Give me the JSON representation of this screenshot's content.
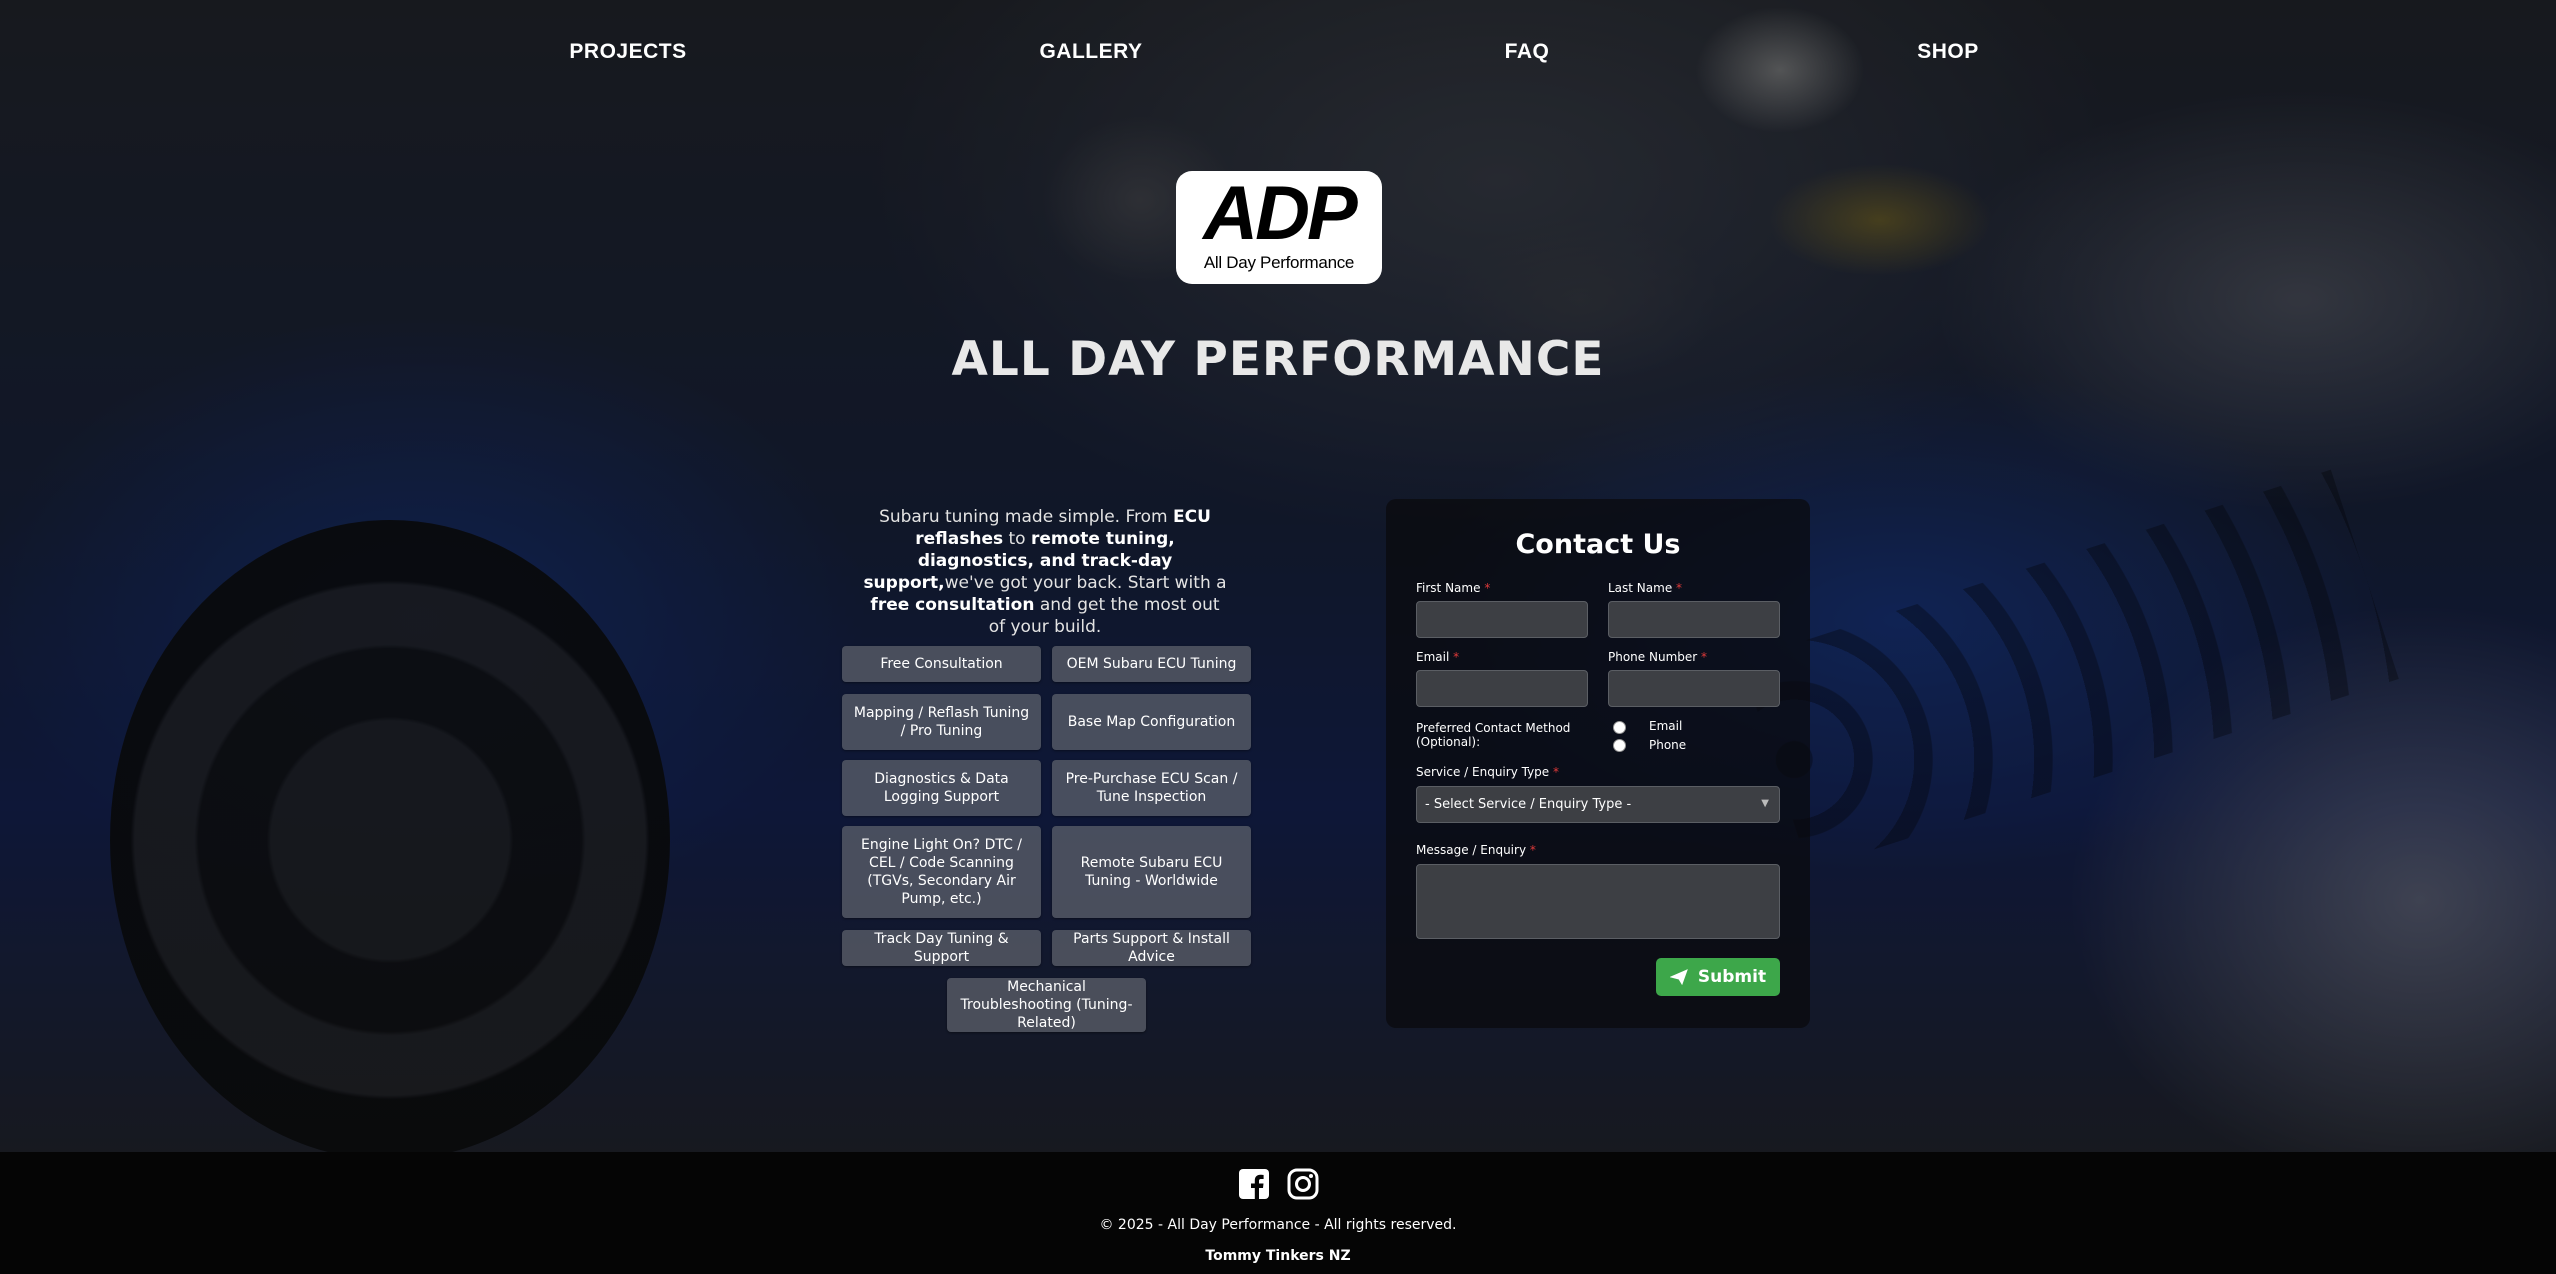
{
  "nav": {
    "items": [
      "PROJECTS",
      "GALLERY",
      "FAQ",
      "SHOP"
    ]
  },
  "logo": {
    "mark": "ADP",
    "tagline": "All Day Performance"
  },
  "hero": {
    "title": "ALL DAY PERFORMANCE"
  },
  "intro": {
    "p1": "Subaru tuning made simple. From ",
    "b1": "ECU reflashes",
    "p2": " to ",
    "b2": "remote tuning, diagnostics, and track-day support,",
    "p3": "we've got your back. Start with a ",
    "b3": "free consultation",
    "p4": " and get the most out of your build."
  },
  "services": [
    "Free Consultation",
    "OEM Subaru ECU Tuning",
    "Mapping / Reflash Tuning / Pro Tuning",
    "Base Map Configuration",
    "Diagnostics & Data Logging Support",
    "Pre-Purchase ECU Scan / Tune Inspection",
    "Engine Light On? DTC / CEL / Code Scanning (TGVs, Secondary Air Pump, etc.)",
    "Remote Subaru ECU Tuning - Worldwide",
    "Track Day Tuning & Support",
    "Parts Support & Install Advice",
    "Mechanical Troubleshooting (Tuning-Related)"
  ],
  "contact": {
    "title": "Contact Us",
    "first_name_label": "First Name",
    "last_name_label": "Last Name",
    "email_label": "Email",
    "phone_label": "Phone Number",
    "required_mark": "*",
    "preferred_label": "Preferred Contact Method (Optional):",
    "pref_options": [
      "Email",
      "Phone"
    ],
    "service_label": "Service / Enquiry Type",
    "service_selected": "- Select Service / Enquiry Type -",
    "message_label": "Message / Enquiry",
    "submit_label": "Submit"
  },
  "footer": {
    "social_icons": [
      "facebook-icon",
      "instagram-icon"
    ],
    "copyright": "© 2025 - All Day Performance - All rights reserved.",
    "credit": "Tommy Tinkers NZ"
  },
  "colors": {
    "submit": "#3da74a",
    "required": "#e03a3a",
    "footer_bg": "#050505"
  }
}
